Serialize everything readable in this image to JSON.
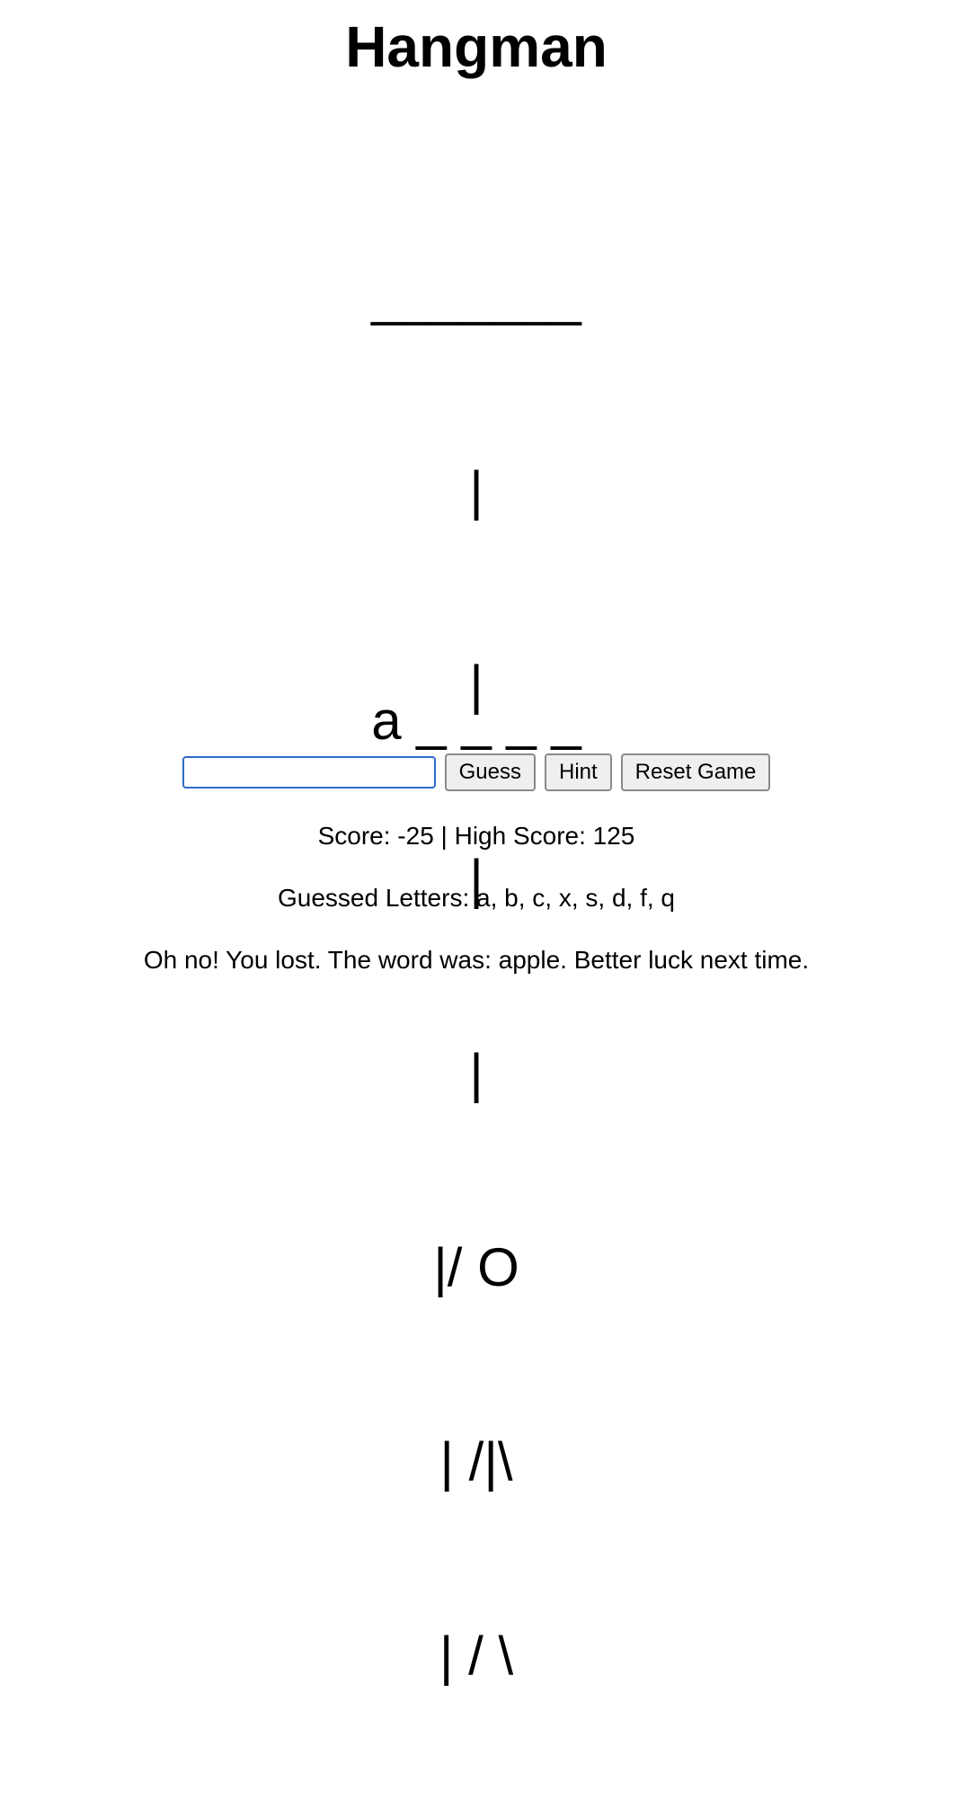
{
  "title": "Hangman",
  "gallows": {
    "lines": [
      "_______",
      "|",
      "|",
      "|",
      "|",
      "|/ O",
      "| /|\\",
      "| / \\"
    ]
  },
  "word_display": "a _ _ _ _",
  "guess_input": {
    "value": "",
    "placeholder": ""
  },
  "buttons": {
    "guess_label": "Guess",
    "hint_label": "Hint",
    "reset_label": "Reset Game"
  },
  "score_line": "Score: -25 | High Score: 125",
  "guessed_letters_line": "Guessed Letters: a, b, c, x, s, d, f, q",
  "status_message": "Oh no! You lost. The word was: apple. Better luck next time."
}
